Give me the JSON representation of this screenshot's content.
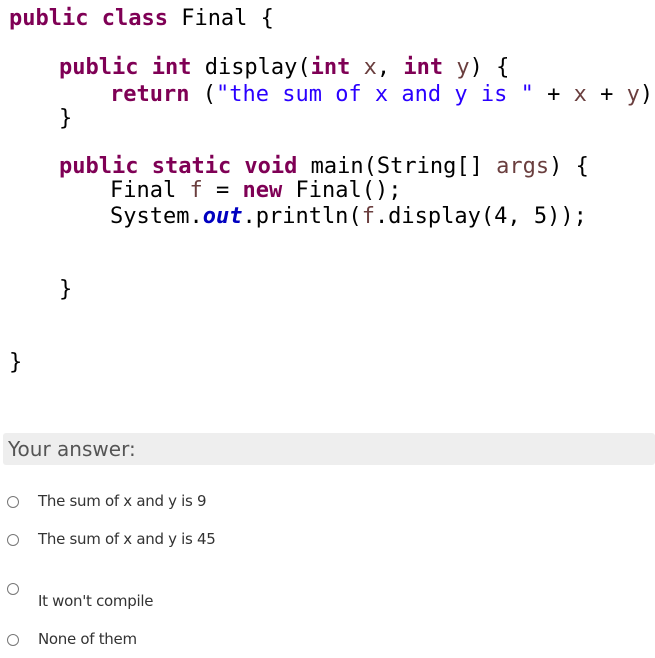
{
  "question": {
    "code_lines": [
      "public class Final {",
      "    public int display(int x, int y) {",
      "        return (\"the sum of x and y is \" + x + y);",
      "    }",
      "    public static void main(String[] args) {",
      "        Final f = new Final();",
      "        System.out.println(f.display(4, 5));",
      "    }",
      "}"
    ]
  },
  "answer_header": "Your answer:",
  "options": [
    {
      "label": "The sum of x and y is 9",
      "selected": false
    },
    {
      "label": "The sum of x and y is 45",
      "selected": false
    },
    {
      "label": "It won't compile",
      "selected": false
    },
    {
      "label": "None of them",
      "selected": false
    }
  ],
  "colors": {
    "keyword": "#7f0055",
    "string": "#2a00ff",
    "local_variable": "#6a3e3e",
    "static_field": "#0000c0",
    "header_background": "#eeeeee"
  }
}
